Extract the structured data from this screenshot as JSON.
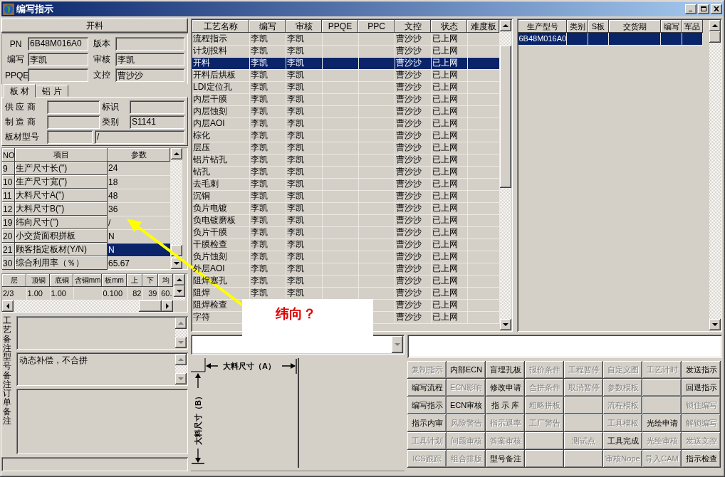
{
  "window": {
    "title": "编写指示"
  },
  "header": {
    "label": "开料"
  },
  "info": [
    {
      "label": "PN",
      "value": "6B48M016A0"
    },
    {
      "label": "版本"
    },
    {
      "label": "编写",
      "value": "李凯"
    },
    {
      "label": "审核",
      "value": "李凯"
    },
    {
      "label": "PPQE"
    },
    {
      "label": "文控",
      "value": "曹沙沙"
    }
  ],
  "tabs": [
    {
      "label": "板 材",
      "selected": true
    },
    {
      "label": "铝 片",
      "selected": false
    }
  ],
  "material": {
    "fields": [
      {
        "label": "供 应 商"
      },
      {
        "label": "标识"
      },
      {
        "label": "制 造 商"
      },
      {
        "label": "类别",
        "value": "S1141"
      }
    ],
    "type_row": {
      "label": "板材型号",
      "second_value": "/"
    }
  },
  "param_grid": {
    "columns": [
      "NO",
      "项目",
      "参数"
    ],
    "rows": [
      {
        "no": "9",
        "item": "生产尺寸长(\")",
        "value": "24",
        "selected": false
      },
      {
        "no": "10",
        "item": "生产尺寸宽(\")",
        "value": "18",
        "selected": false
      },
      {
        "no": "11",
        "item": "大料尺寸A(\")",
        "value": "48",
        "selected": false
      },
      {
        "no": "12",
        "item": "大料尺寸B(\")",
        "value": "36",
        "selected": false
      },
      {
        "no": "19",
        "item": "纬向尺寸(\")",
        "value": "/",
        "selected": false
      },
      {
        "no": "20",
        "item": "小交货面积拼板",
        "value": "N",
        "selected": false
      },
      {
        "no": "21",
        "item": "顾客指定板材(Y/N)",
        "value": "N",
        "selected": true
      },
      {
        "no": "30",
        "item": "综合利用率（％）",
        "value": "65.67",
        "selected": false
      }
    ]
  },
  "layer_grid": {
    "columns": [
      "层",
      "顶铜",
      "底铜",
      "含铜mm",
      "板mm",
      "上",
      "下",
      "均"
    ],
    "rows": [
      {
        "layer": "2/3",
        "top_cu": "1.00",
        "bottom_cu": "1.00",
        "board_mm": "0.100",
        "upper": "82",
        "lower": "39",
        "average": "60."
      }
    ]
  },
  "remarks": [
    {
      "label": "工艺备注",
      "kind": "scroll"
    },
    {
      "label": "型号备注",
      "kind": "scroll",
      "value": "动态补偿，不合拼"
    },
    {
      "label": "订单备注",
      "kind": "plain"
    }
  ],
  "process_table": {
    "columns": [
      "工艺名称",
      "编写",
      "审核",
      "PPQE",
      "PPC",
      "文控",
      "状态",
      "难度板"
    ],
    "rows": [
      {
        "name": "流程指示",
        "writer": "李凯",
        "reviewer": "李凯",
        "doc_control": "曹沙沙",
        "status": "已上网",
        "selected": false
      },
      {
        "name": "计划投料",
        "writer": "李凯",
        "reviewer": "李凯",
        "doc_control": "曹沙沙",
        "status": "已上网",
        "selected": false
      },
      {
        "name": "开料",
        "writer": "李凯",
        "reviewer": "李凯",
        "doc_control": "曹沙沙",
        "status": "已上网",
        "selected": true
      },
      {
        "name": "开料后烘板",
        "writer": "李凯",
        "reviewer": "李凯",
        "doc_control": "曹沙沙",
        "status": "已上网",
        "selected": false
      },
      {
        "name": "LDI定位孔",
        "writer": "李凯",
        "reviewer": "李凯",
        "doc_control": "曹沙沙",
        "status": "已上网",
        "selected": false
      },
      {
        "name": "内层干膜",
        "writer": "李凯",
        "reviewer": "李凯",
        "doc_control": "曹沙沙",
        "status": "已上网",
        "selected": false
      },
      {
        "name": "内层蚀刻",
        "writer": "李凯",
        "reviewer": "李凯",
        "doc_control": "曹沙沙",
        "status": "已上网",
        "selected": false
      },
      {
        "name": "内层AOI",
        "writer": "李凯",
        "reviewer": "李凯",
        "doc_control": "曹沙沙",
        "status": "已上网",
        "selected": false
      },
      {
        "name": "棕化",
        "writer": "李凯",
        "reviewer": "李凯",
        "doc_control": "曹沙沙",
        "status": "已上网",
        "selected": false
      },
      {
        "name": "层压",
        "writer": "李凯",
        "reviewer": "李凯",
        "doc_control": "曹沙沙",
        "status": "已上网",
        "selected": false
      },
      {
        "name": "铝片钻孔",
        "writer": "李凯",
        "reviewer": "李凯",
        "doc_control": "曹沙沙",
        "status": "已上网",
        "selected": false
      },
      {
        "name": "钻孔",
        "writer": "李凯",
        "reviewer": "李凯",
        "doc_control": "曹沙沙",
        "status": "已上网",
        "selected": false
      },
      {
        "name": "去毛刺",
        "writer": "李凯",
        "reviewer": "李凯",
        "doc_control": "曹沙沙",
        "status": "已上网",
        "selected": false
      },
      {
        "name": "沉铜",
        "writer": "李凯",
        "reviewer": "李凯",
        "doc_control": "曹沙沙",
        "status": "已上网",
        "selected": false
      },
      {
        "name": "负片电镀",
        "writer": "李凯",
        "reviewer": "李凯",
        "doc_control": "曹沙沙",
        "status": "已上网",
        "selected": false
      },
      {
        "name": "负电镀磨板",
        "writer": "李凯",
        "reviewer": "李凯",
        "doc_control": "曹沙沙",
        "status": "已上网",
        "selected": false
      },
      {
        "name": "负片干膜",
        "writer": "李凯",
        "reviewer": "李凯",
        "doc_control": "曹沙沙",
        "status": "已上网",
        "selected": false
      },
      {
        "name": "干膜检查",
        "writer": "李凯",
        "reviewer": "李凯",
        "doc_control": "曹沙沙",
        "status": "已上网",
        "selected": false
      },
      {
        "name": "负片蚀刻",
        "writer": "李凯",
        "reviewer": "李凯",
        "doc_control": "曹沙沙",
        "status": "已上网",
        "selected": false
      },
      {
        "name": "外层AOI",
        "writer": "李凯",
        "reviewer": "李凯",
        "doc_control": "曹沙沙",
        "status": "已上网",
        "selected": false
      },
      {
        "name": "阻焊塞孔",
        "writer": "李凯",
        "reviewer": "李凯",
        "doc_control": "曹沙沙",
        "status": "已上网",
        "selected": false
      },
      {
        "name": "阻焊",
        "writer": "李凯",
        "reviewer": "李凯",
        "doc_control": "曹沙沙",
        "status": "已上网",
        "selected": false
      },
      {
        "name": "阻焊检查",
        "doc_control": "曹沙沙",
        "status": "已上网",
        "selected": false
      },
      {
        "name": "字符",
        "doc_control": "曹沙沙",
        "status": "已上网",
        "selected": false
      }
    ]
  },
  "model_table": {
    "columns": [
      "生产型号",
      "类别",
      "S板",
      "交货期",
      "编写",
      "军品"
    ],
    "rows": [
      {
        "model": "6B48M016A0",
        "selected": true
      }
    ]
  },
  "diagram": {
    "width_label": "大料尺寸（A）",
    "height_label": "大料尺寸（B）"
  },
  "buttons": [
    {
      "kind": "button",
      "label": "复制指示",
      "disabled": true
    },
    {
      "kind": "button",
      "label": "内部ECN",
      "disabled": false
    },
    {
      "kind": "button",
      "label": "盲埋孔板",
      "disabled": false
    },
    {
      "kind": "button",
      "label": "报价条件",
      "disabled": true
    },
    {
      "kind": "button",
      "label": "工程暂停",
      "disabled": true
    },
    {
      "kind": "button",
      "label": "自定义图",
      "disabled": true
    },
    {
      "kind": "button",
      "label": "工艺计时",
      "disabled": true
    },
    {
      "kind": "button",
      "label": "发送指示",
      "disabled": false
    },
    {
      "kind": "button",
      "label": "编写流程",
      "disabled": false
    },
    {
      "kind": "button",
      "label": "ECN影响",
      "disabled": true
    },
    {
      "kind": "button",
      "label": "修改申请",
      "disabled": false
    },
    {
      "kind": "button",
      "label": "合拼条件",
      "disabled": true
    },
    {
      "kind": "button",
      "label": "取消暂停",
      "disabled": true
    },
    {
      "kind": "button",
      "label": "参数模板",
      "disabled": true
    },
    {
      "kind": "blank"
    },
    {
      "kind": "button",
      "label": "回退指示",
      "disabled": false
    },
    {
      "kind": "button",
      "label": "编写指示",
      "disabled": false
    },
    {
      "kind": "button",
      "label": "ECN审核",
      "disabled": false
    },
    {
      "kind": "button",
      "label": "指 示 库",
      "disabled": false
    },
    {
      "kind": "button",
      "label": "粗略拼板",
      "disabled": true
    },
    {
      "kind": "blank"
    },
    {
      "kind": "button",
      "label": "流程模板",
      "disabled": true
    },
    {
      "kind": "blank"
    },
    {
      "kind": "button",
      "label": "锁住编写",
      "disabled": true
    },
    {
      "kind": "button",
      "label": "指示内审",
      "disabled": false
    },
    {
      "kind": "button",
      "label": "风险警告",
      "disabled": true
    },
    {
      "kind": "button",
      "label": "指示退率",
      "disabled": true
    },
    {
      "kind": "button",
      "label": "工厂警告",
      "disabled": true
    },
    {
      "kind": "blank"
    },
    {
      "kind": "button",
      "label": "工具模板",
      "disabled": true
    },
    {
      "kind": "button",
      "label": "光绘申请",
      "disabled": false
    },
    {
      "kind": "button",
      "label": "解锁编写",
      "disabled": true
    },
    {
      "kind": "button",
      "label": "工具计划",
      "disabled": true
    },
    {
      "kind": "button",
      "label": "问题审核",
      "disabled": true
    },
    {
      "kind": "button",
      "label": "答案审核",
      "disabled": true
    },
    {
      "kind": "blank"
    },
    {
      "kind": "button",
      "label": "测试点",
      "disabled": true
    },
    {
      "kind": "button",
      "label": "工具完成",
      "disabled": false
    },
    {
      "kind": "button",
      "label": "光绘审核",
      "disabled": true
    },
    {
      "kind": "button",
      "label": "发送文控",
      "disabled": true
    },
    {
      "kind": "button",
      "label": "ICS跟踪",
      "disabled": true
    },
    {
      "kind": "button",
      "label": "组合排版",
      "disabled": true
    },
    {
      "kind": "button",
      "label": "型号备注",
      "disabled": false
    },
    {
      "kind": "blank"
    },
    {
      "kind": "blank"
    },
    {
      "kind": "button",
      "label": "审核Nope",
      "disabled": true
    },
    {
      "kind": "button",
      "label": "导入CAM",
      "disabled": true
    },
    {
      "kind": "button",
      "label": "指示检查",
      "disabled": false
    }
  ],
  "annotation": {
    "text": "纬向？"
  }
}
